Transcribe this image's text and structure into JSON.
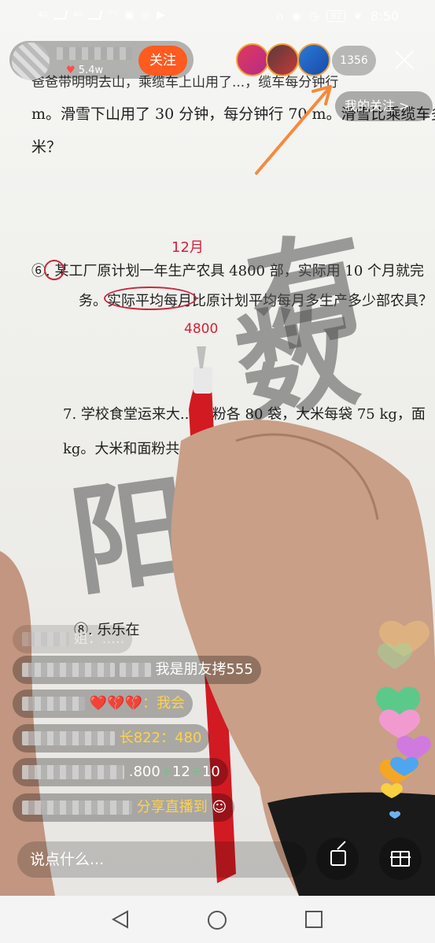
{
  "status_bar": {
    "network_1": "4G",
    "network_2": "4G",
    "battery": "97",
    "time": "8:50"
  },
  "host": {
    "likes": "5.4w",
    "follow_label": "关注"
  },
  "viewers": {
    "count": "1356"
  },
  "my_follow": {
    "label": "我的关注 >"
  },
  "worksheet": {
    "line1": "爸爸带明明去山，乘缆车上山用了...，缆车每分钟行",
    "line2": "m。滑雪下山用了 30 分钟，每分钟行 70 m。滑雪比乘缆车多行多",
    "line3": "米？",
    "q6_line1": "⑥. 某工厂原计划一年生产农具 4800 部，实际用 10 个月就完",
    "q6_line2": "务。实际平均每月比原计划平均每月多生产多少部农具？",
    "q7_line1": "7. 学校食堂运来大... 面粉各 80 袋，大米每袋 75 kg，面",
    "q7_line2": "kg。大米和面粉共... (用两种方法解答)？",
    "q8_line": "⑧. 乐乐在",
    "note_12": "12月",
    "note_4800": "4800",
    "watermark_1": "阳",
    "watermark_2": "数",
    "watermark_3": "有"
  },
  "chat": {
    "line0_tail": "姐：.....",
    "line1_tail": "我是朋友拷555",
    "line2_hearts": "❤️💔💔",
    "line2_text": "：我会",
    "line3_tail": "长822：480",
    "line4_tail": ".800 ÷ 12 ÷ 10",
    "line4_a": ".800",
    "line4_b": "12",
    "line4_c": "10",
    "line4_div": "÷",
    "line5_tail": "分享直播到"
  },
  "bottom_bar": {
    "comment_placeholder": "说点什么..."
  },
  "colors": {
    "accent": "#ff5a1f",
    "ink_red": "#d0243a",
    "gold_text": "#ffd24a",
    "green_text": "#52d672"
  }
}
